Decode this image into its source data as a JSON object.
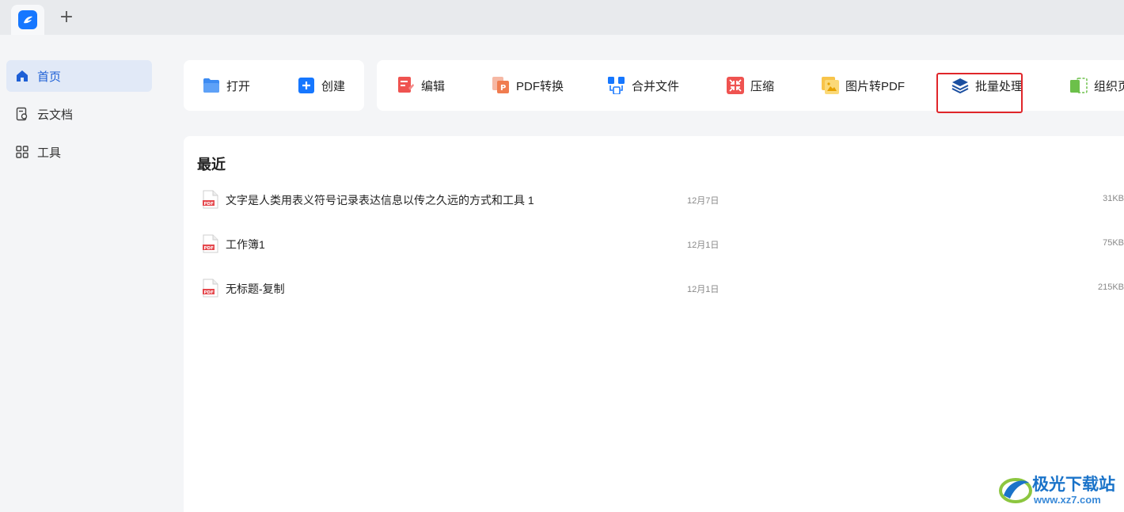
{
  "tabbar": {
    "add_tab": "+"
  },
  "sidebar": {
    "items": [
      {
        "label": "首页",
        "icon": "home-icon",
        "active": true
      },
      {
        "label": "云文档",
        "icon": "cloud-doc-icon",
        "active": false
      },
      {
        "label": "工具",
        "icon": "grid-icon",
        "active": false
      }
    ]
  },
  "quick_actions": {
    "open": "打开",
    "create": "创建"
  },
  "tools": {
    "edit": "编辑",
    "pdf_convert": "PDF转换",
    "merge": "合并文件",
    "compress": "压缩",
    "image_to_pdf": "图片转PDF",
    "batch": "批量处理",
    "organize": "组织页"
  },
  "recent": {
    "title": "最近",
    "files": [
      {
        "name": "文字是人类用表义符号记录表达信息以传之久远的方式和工具 1",
        "date": "12月7日",
        "size": "31KB",
        "type_label": "PDF"
      },
      {
        "name": "工作簿1",
        "date": "12月1日",
        "size": "75KB",
        "type_label": "PDF"
      },
      {
        "name": "无标题-复制",
        "date": "12月1日",
        "size": "215KB",
        "type_label": "PDF"
      }
    ]
  },
  "watermark": {
    "title": "极光下载站",
    "url": "www.xz7.com"
  },
  "colors": {
    "accent": "#1d5fd6",
    "highlight": "#e0262a",
    "pdf_red": "#e5484d"
  }
}
